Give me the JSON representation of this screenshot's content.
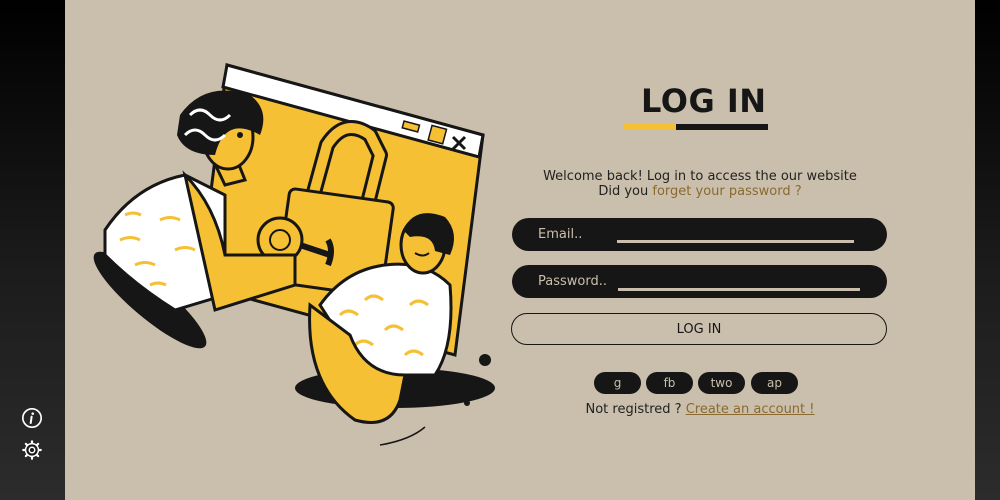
{
  "sidebar": {
    "icons": [
      "info-icon",
      "gear-icon"
    ]
  },
  "login": {
    "title": "LOG IN",
    "welcome_text": "Welcome back! Log in to access the our website",
    "forgot_prefix": "Did you",
    "forgot_link": "forget your password ?",
    "email_label": "Email..",
    "password_label": "Password..",
    "button_label": "LOG IN"
  },
  "social": [
    {
      "label": "g"
    },
    {
      "label": "fb"
    },
    {
      "label": "two"
    },
    {
      "label": "ap"
    }
  ],
  "register": {
    "prefix": "Not registred ?",
    "link": "Create an account !"
  },
  "colors": {
    "background": "#cabfac",
    "accent": "#f6c034",
    "dark": "#161616",
    "link": "#8a6a2e"
  },
  "illustration": {
    "icon": "lock-illustration"
  }
}
